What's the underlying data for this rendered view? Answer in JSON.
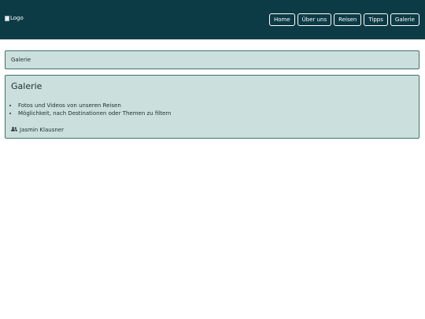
{
  "header": {
    "logo_alt": "Logo",
    "nav": [
      "Home",
      "Über uns",
      "Reisen",
      "Tipps",
      "Galerie"
    ]
  },
  "breadcrumb": {
    "label": "Galerie"
  },
  "card": {
    "title": "Galerie",
    "features": [
      "Fotos und Videos von unseren Reisen",
      "Möglichkeit, nach Destinationen oder Themen zu filtern"
    ],
    "author_icon": "users-icon",
    "author": "Jasmin Klausner"
  },
  "colors": {
    "header_bg": "#0c3b45",
    "panel_bg": "#cbe0dc",
    "panel_border": "#3f6f70"
  }
}
